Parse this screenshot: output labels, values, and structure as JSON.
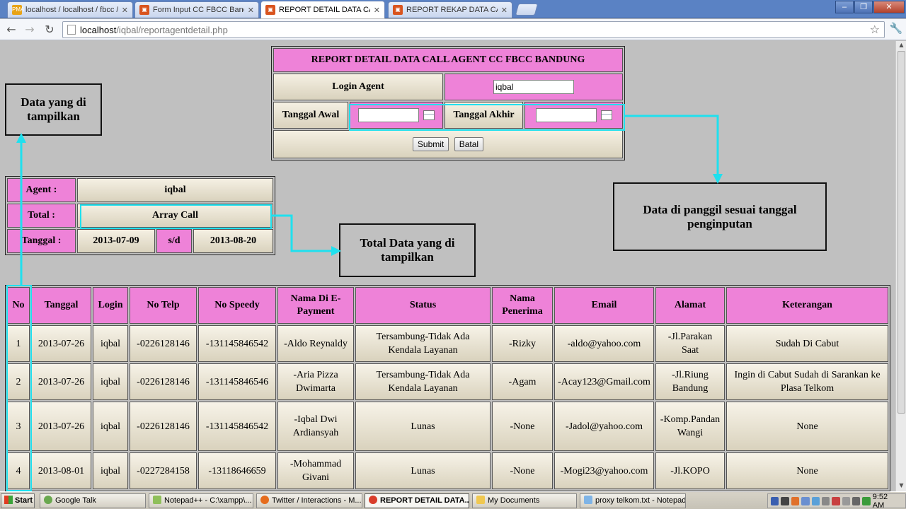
{
  "browser": {
    "tabs": [
      {
        "title": "localhost / localhost / fbcc / c",
        "active": false
      },
      {
        "title": "Form Input CC FBCC Bandun",
        "active": false
      },
      {
        "title": "REPORT DETAIL DATA CALL",
        "active": true
      },
      {
        "title": "REPORT REKAP DATA CALL",
        "active": false
      }
    ],
    "url_host": "localhost",
    "url_path": "/iqbal/reportagentdetail.php"
  },
  "form": {
    "title": "REPORT DETAIL DATA CALL AGENT CC FBCC BANDUNG",
    "login_label": "Login Agent",
    "login_value": "iqbal",
    "start_label": "Tanggal Awal",
    "end_label": "Tanggal Akhir",
    "start_value": "",
    "end_value": "",
    "submit_label": "Submit",
    "cancel_label": "Batal"
  },
  "summary": {
    "agent_label": "Agent :",
    "agent_value": "iqbal",
    "total_label": "Total :",
    "total_value": "Array Call",
    "date_label": "Tanggal :",
    "date_from": "2013-07-09",
    "date_sep": "s/d",
    "date_to": "2013-08-20"
  },
  "annotations": {
    "data_shown": "Data yang di tampilkan",
    "date_called": "Data di panggil sesuai tanggal penginputan",
    "total_shown": "Total Data yang di tampilkan"
  },
  "table": {
    "headers": [
      "No",
      "Tanggal",
      "Login",
      "No Telp",
      "No Speedy",
      "Nama Di E-Payment",
      "Status",
      "Nama Penerima",
      "Email",
      "Alamat",
      "Keterangan"
    ],
    "rows": [
      [
        "1",
        "2013-07-26",
        "iqbal",
        "-0226128146",
        "-131145846542",
        "-Aldo Reynaldy",
        "Tersambung-Tidak Ada Kendala Layanan",
        "-Rizky",
        "-aldo@yahoo.com",
        "-Jl.Parakan Saat",
        "Sudah Di Cabut"
      ],
      [
        "2",
        "2013-07-26",
        "iqbal",
        "-0226128146",
        "-131145846546",
        "-Aria Pizza Dwimarta",
        "Tersambung-Tidak Ada Kendala Layanan",
        "-Agam",
        "-Acay123@Gmail.com",
        "-Jl.Riung Bandung",
        "Ingin di Cabut Sudah di Sarankan ke Plasa Telkom"
      ],
      [
        "3",
        "2013-07-26",
        "iqbal",
        "-0226128146",
        "-131145846542",
        "-Iqbal Dwi Ardiansyah",
        "Lunas",
        "-None",
        "-Jadol@yahoo.com",
        "-Komp.Pandan Wangi",
        "None"
      ],
      [
        "4",
        "2013-08-01",
        "iqbal",
        "-0227284158",
        "-13118646659",
        "-Mohammad Givani",
        "Lunas",
        "-None",
        "-Mogi23@yahoo.com",
        "-Jl.KOPO",
        "None"
      ]
    ]
  },
  "taskbar": {
    "start_label": "Start",
    "items": [
      {
        "label": "Google Talk",
        "active": false
      },
      {
        "label": "Notepad++ - C:\\xampp\\...",
        "active": false
      },
      {
        "label": "Twitter / Interactions - M...",
        "active": false
      },
      {
        "label": "REPORT DETAIL DATA...",
        "active": true
      },
      {
        "label": "My Documents",
        "active": false
      },
      {
        "label": "proxy telkom.txt - Notepad",
        "active": false
      }
    ],
    "clock": "9:52 AM"
  }
}
